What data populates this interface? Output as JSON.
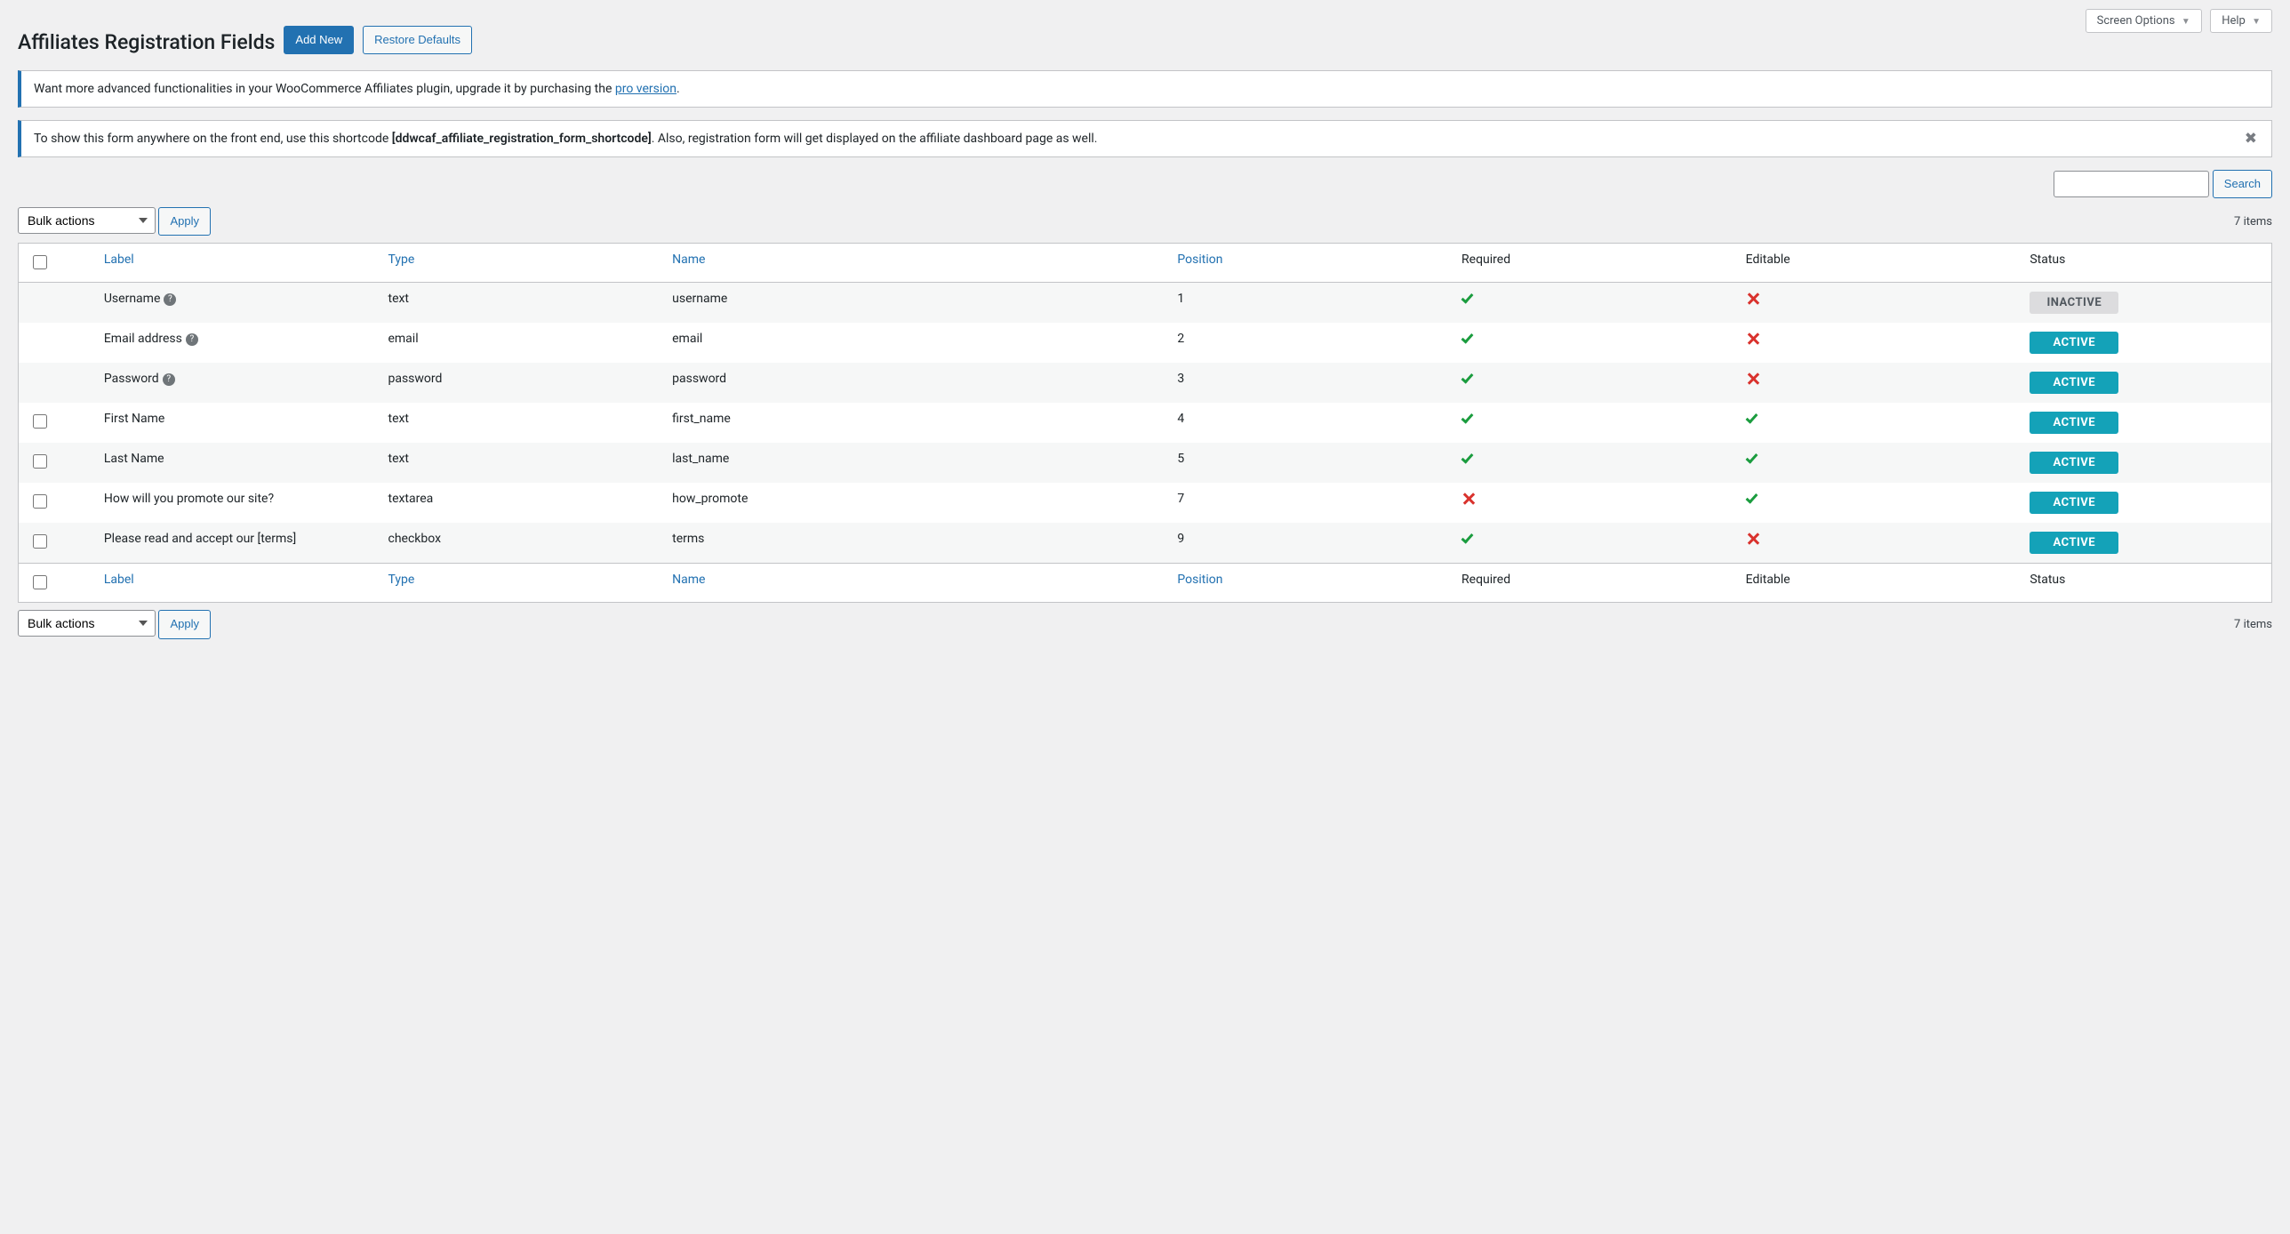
{
  "screen_options_label": "Screen Options",
  "help_label": "Help",
  "page_title": "Affiliates Registration Fields",
  "add_new_label": "Add New",
  "restore_defaults_label": "Restore Defaults",
  "notice_upgrade": {
    "prefix": "Want more advanced functionalities in your WooCommerce Affiliates plugin, upgrade it by purchasing the ",
    "link_text": "pro version",
    "suffix": "."
  },
  "notice_shortcode": {
    "prefix": "To show this form anywhere on the front end, use this shortcode ",
    "code": "[ddwcaf_affiliate_registration_form_shortcode]",
    "suffix": ". Also, registration form will get displayed on the affiliate dashboard page as well."
  },
  "search_button": "Search",
  "bulk_actions_label": "Bulk actions",
  "apply_label": "Apply",
  "items_count_text": "7 items",
  "columns": {
    "label": "Label",
    "type": "Type",
    "name": "Name",
    "position": "Position",
    "required": "Required",
    "editable": "Editable",
    "status": "Status"
  },
  "status_labels": {
    "active": "ACTIVE",
    "inactive": "INACTIVE"
  },
  "rows": [
    {
      "has_checkbox": false,
      "label": "Username",
      "has_help": true,
      "type": "text",
      "name": "username",
      "position": "1",
      "required": true,
      "editable": false,
      "status": "inactive"
    },
    {
      "has_checkbox": false,
      "label": "Email address",
      "has_help": true,
      "type": "email",
      "name": "email",
      "position": "2",
      "required": true,
      "editable": false,
      "status": "active"
    },
    {
      "has_checkbox": false,
      "label": "Password",
      "has_help": true,
      "type": "password",
      "name": "password",
      "position": "3",
      "required": true,
      "editable": false,
      "status": "active"
    },
    {
      "has_checkbox": true,
      "label": "First Name",
      "has_help": false,
      "type": "text",
      "name": "first_name",
      "position": "4",
      "required": true,
      "editable": true,
      "status": "active"
    },
    {
      "has_checkbox": true,
      "label": "Last Name",
      "has_help": false,
      "type": "text",
      "name": "last_name",
      "position": "5",
      "required": true,
      "editable": true,
      "status": "active"
    },
    {
      "has_checkbox": true,
      "label": "How will you promote our site?",
      "has_help": false,
      "type": "textarea",
      "name": "how_promote",
      "position": "7",
      "required": false,
      "editable": true,
      "status": "active"
    },
    {
      "has_checkbox": true,
      "label": "Please read and accept our [terms]",
      "has_help": false,
      "type": "checkbox",
      "name": "terms",
      "position": "9",
      "required": true,
      "editable": false,
      "status": "active"
    }
  ]
}
